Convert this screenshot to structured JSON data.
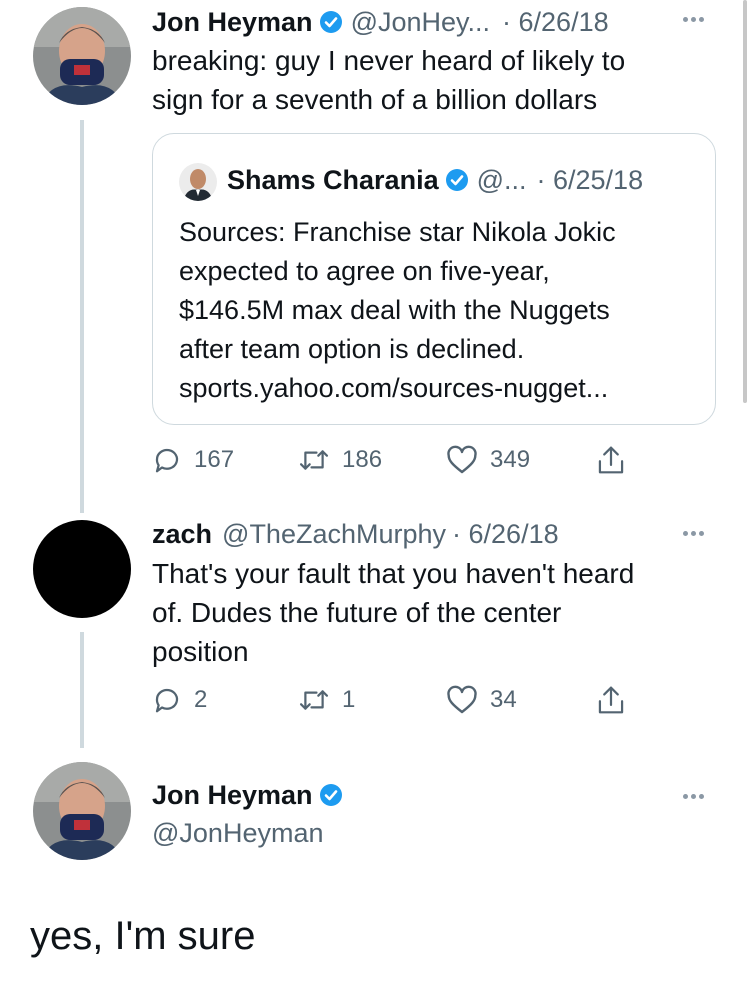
{
  "tweet1": {
    "name": "Jon Heyman",
    "handle": "@JonHey...",
    "date": "· 6/26/18",
    "text_line1": "breaking: guy I never heard of likely to",
    "text_line2": "sign for a seventh of a billion dollars",
    "quote": {
      "name": "Shams Charania",
      "handle": "@...",
      "date": "· 6/25/18",
      "lines": [
        "Sources: Franchise star Nikola Jokic",
        "expected to agree on five-year,",
        "$146.5M max deal with the Nuggets",
        "after team option is declined.",
        "sports.yahoo.com/sources-nugget..."
      ]
    },
    "replies": "167",
    "retweets": "186",
    "likes": "349"
  },
  "tweet2": {
    "name": "zach",
    "handle": "@TheZachMurphy",
    "date": "· 6/26/18",
    "text_line1": "That's your fault that you haven't heard",
    "text_line2": "of. Dudes the future of the center",
    "text_line3": "position",
    "replies": "2",
    "retweets": "1",
    "likes": "34"
  },
  "tweet3": {
    "name": "Jon Heyman",
    "handle": "@JonHeyman",
    "text": "yes, I'm sure"
  },
  "colors": {
    "verified": "#1d9bf0",
    "muted": "#536471",
    "border": "#cfd9de"
  },
  "icons": {
    "reply": "reply-icon",
    "retweet": "retweet-icon",
    "like": "like-icon",
    "share": "share-icon",
    "verified": "verified-badge-icon",
    "more": "more-icon"
  }
}
